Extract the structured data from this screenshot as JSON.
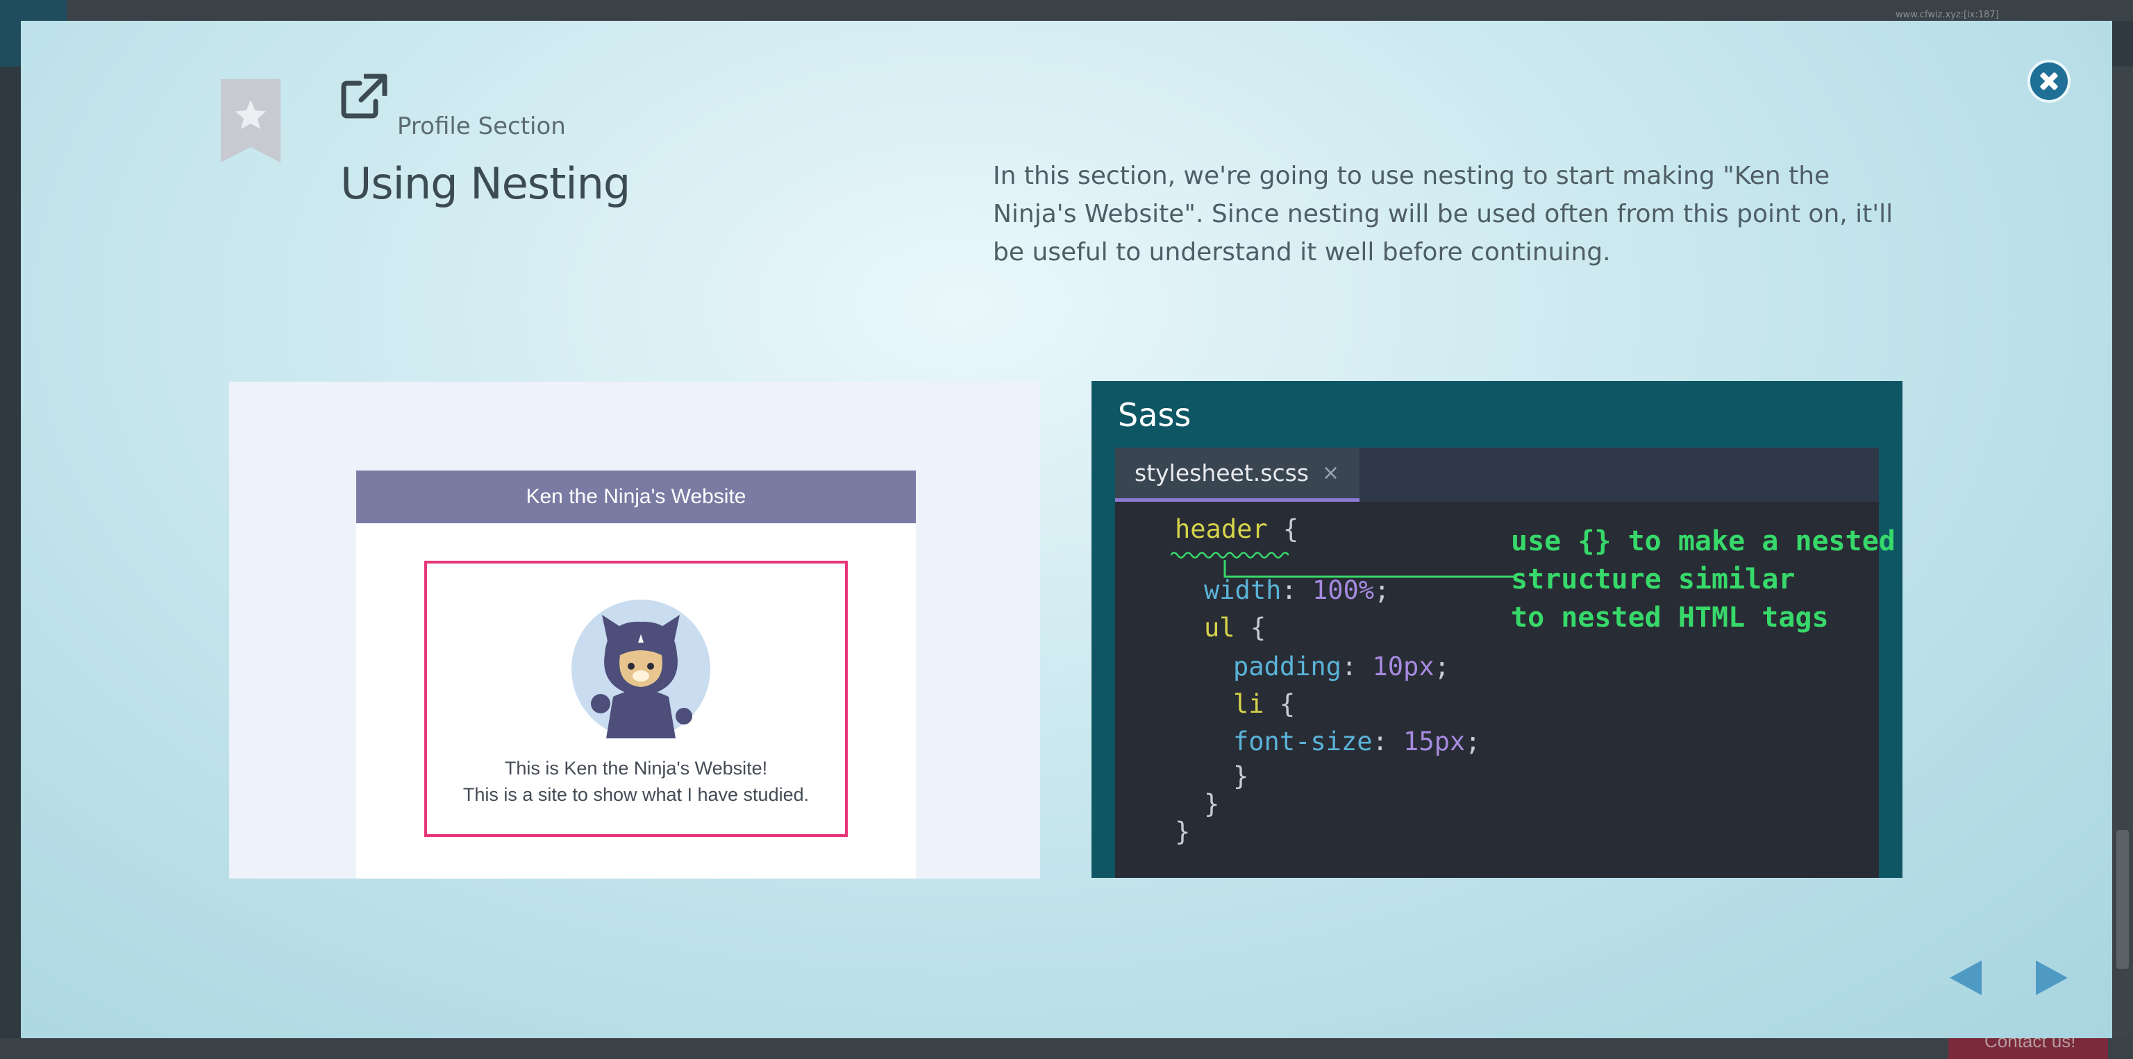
{
  "background_page": {
    "url_text": "www.cfwiz.xyz:[ix:187]",
    "contact_label": "Contact us!"
  },
  "modal": {
    "section_label": "Profile Section",
    "lesson_title": "Using Nesting",
    "description": "In this section, we're going to use nesting to start making \"Ken the Ninja's Website\". Since nesting will be used often from this point on, it'll be useful to understand it well before continuing.",
    "icons": {
      "close": "close-icon",
      "bookmark": "star-bookmark-icon",
      "section_link": "external-link-icon",
      "prev": "triangle-left-icon",
      "next": "triangle-right-icon"
    },
    "colors": {
      "accent": "#1f6f96",
      "nav_arrow": "#4f9ac4",
      "highlight_border": "#e8357a",
      "site_header": "#7a7ba2",
      "sass_panel": "#0f5664",
      "annotation": "#37d96a"
    }
  },
  "preview": {
    "site_title": "Ken the Ninja's Website",
    "line1": "This is Ken the Ninja's Website!",
    "line2": "This is a site to show what I have studied."
  },
  "sass": {
    "title": "Sass",
    "tab_name": "stylesheet.scss",
    "tab_close": "×",
    "code": {
      "l1_sel": "header",
      "l1_brace": " {",
      "l2_prop": "width",
      "l2_colon": ": ",
      "l2_val": "100%",
      "l2_semi": ";",
      "l3_sel": "ul",
      "l3_brace": " {",
      "l4_prop": "padding",
      "l4_colon": ": ",
      "l4_val": "10px",
      "l4_semi": ";",
      "l5_sel": "li",
      "l5_brace": " {",
      "l6_prop": "font-size",
      "l6_colon": ": ",
      "l6_val": "15px",
      "l6_semi": ";",
      "l7": "}",
      "l8": "}",
      "l9": "}"
    },
    "annotation": "use {} to make a nested\nstructure similar\nto nested HTML tags"
  }
}
